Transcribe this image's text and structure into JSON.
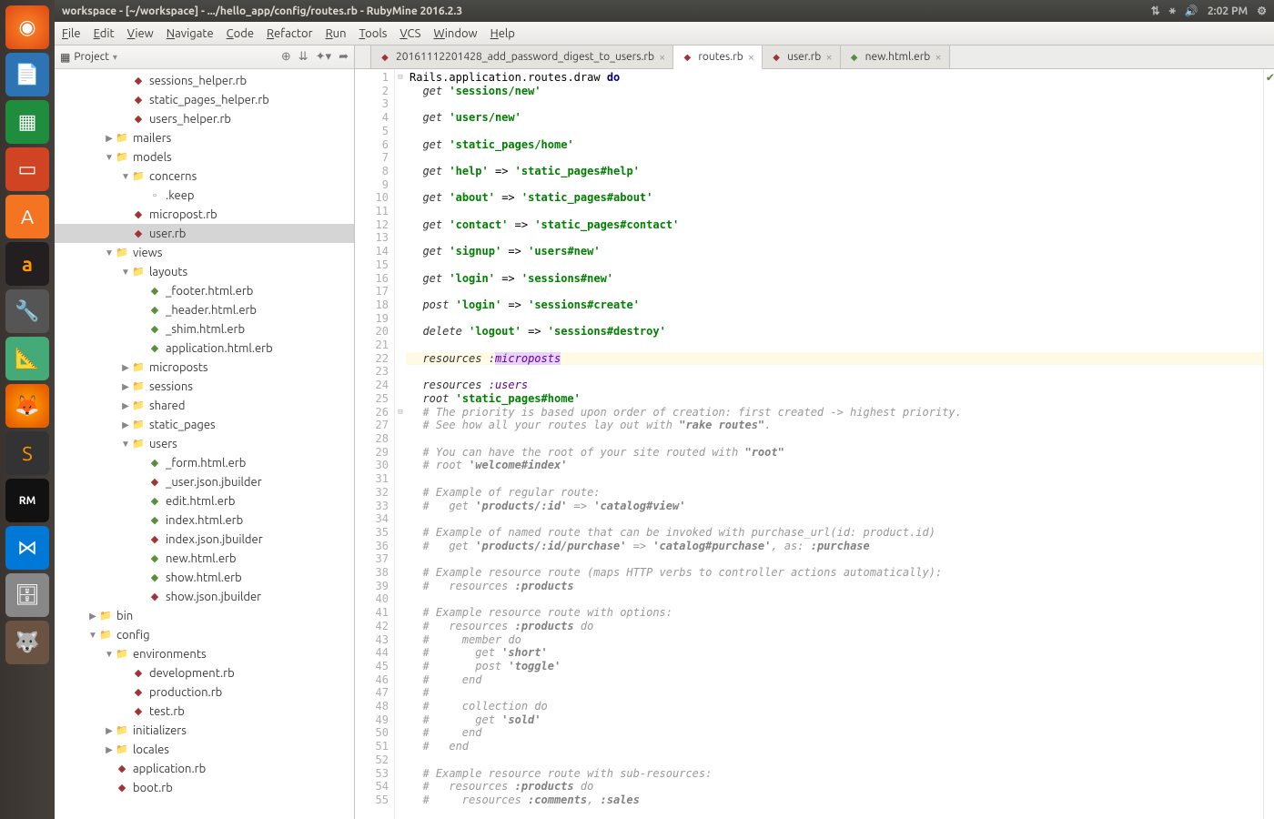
{
  "topbar": {
    "title": "workspace - [~/workspace] - .../hello_app/config/routes.rb - RubyMine 2016.2.3",
    "time": "2:02 PM"
  },
  "menubar": [
    "File",
    "Edit",
    "View",
    "Navigate",
    "Code",
    "Refactor",
    "Run",
    "Tools",
    "VCS",
    "Window",
    "Help"
  ],
  "project_panel_label": "Project",
  "tree": [
    {
      "d": 4,
      "t": "file-rb",
      "n": "sessions_helper.rb"
    },
    {
      "d": 4,
      "t": "file-rb",
      "n": "static_pages_helper.rb"
    },
    {
      "d": 4,
      "t": "file-rb",
      "n": "users_helper.rb"
    },
    {
      "d": 3,
      "t": "folder",
      "n": "mailers",
      "a": "▶"
    },
    {
      "d": 3,
      "t": "folder",
      "n": "models",
      "a": "▼"
    },
    {
      "d": 4,
      "t": "folder",
      "n": "concerns",
      "a": "▼"
    },
    {
      "d": 5,
      "t": "file",
      "n": ".keep"
    },
    {
      "d": 4,
      "t": "file-rb",
      "n": "micropost.rb"
    },
    {
      "d": 4,
      "t": "file-rb",
      "n": "user.rb",
      "sel": true
    },
    {
      "d": 3,
      "t": "folder",
      "n": "views",
      "a": "▼"
    },
    {
      "d": 4,
      "t": "folder",
      "n": "layouts",
      "a": "▼"
    },
    {
      "d": 5,
      "t": "file-erb",
      "n": "_footer.html.erb"
    },
    {
      "d": 5,
      "t": "file-erb",
      "n": "_header.html.erb"
    },
    {
      "d": 5,
      "t": "file-erb",
      "n": "_shim.html.erb"
    },
    {
      "d": 5,
      "t": "file-erb",
      "n": "application.html.erb"
    },
    {
      "d": 4,
      "t": "folder",
      "n": "microposts",
      "a": "▶"
    },
    {
      "d": 4,
      "t": "folder",
      "n": "sessions",
      "a": "▶"
    },
    {
      "d": 4,
      "t": "folder",
      "n": "shared",
      "a": "▶"
    },
    {
      "d": 4,
      "t": "folder",
      "n": "static_pages",
      "a": "▶"
    },
    {
      "d": 4,
      "t": "folder",
      "n": "users",
      "a": "▼"
    },
    {
      "d": 5,
      "t": "file-erb",
      "n": "_form.html.erb"
    },
    {
      "d": 5,
      "t": "file-rb",
      "n": "_user.json.jbuilder"
    },
    {
      "d": 5,
      "t": "file-erb",
      "n": "edit.html.erb"
    },
    {
      "d": 5,
      "t": "file-erb",
      "n": "index.html.erb"
    },
    {
      "d": 5,
      "t": "file-rb",
      "n": "index.json.jbuilder"
    },
    {
      "d": 5,
      "t": "file-erb",
      "n": "new.html.erb"
    },
    {
      "d": 5,
      "t": "file-erb",
      "n": "show.html.erb"
    },
    {
      "d": 5,
      "t": "file-rb",
      "n": "show.json.jbuilder"
    },
    {
      "d": 2,
      "t": "folder",
      "n": "bin",
      "a": "▶"
    },
    {
      "d": 2,
      "t": "folder",
      "n": "config",
      "a": "▼"
    },
    {
      "d": 3,
      "t": "folder",
      "n": "environments",
      "a": "▼"
    },
    {
      "d": 4,
      "t": "file-rb",
      "n": "development.rb"
    },
    {
      "d": 4,
      "t": "file-rb",
      "n": "production.rb"
    },
    {
      "d": 4,
      "t": "file-rb",
      "n": "test.rb"
    },
    {
      "d": 3,
      "t": "folder",
      "n": "initializers",
      "a": "▶"
    },
    {
      "d": 3,
      "t": "folder",
      "n": "locales",
      "a": "▶"
    },
    {
      "d": 3,
      "t": "file-rb",
      "n": "application.rb"
    },
    {
      "d": 3,
      "t": "file-rb",
      "n": "boot.rb"
    }
  ],
  "tabs": [
    {
      "icon": "rb",
      "label": "20161112201428_add_password_digest_to_users.rb",
      "active": false
    },
    {
      "icon": "rb",
      "label": "routes.rb",
      "active": true
    },
    {
      "icon": "rb",
      "label": "user.rb",
      "active": false
    },
    {
      "icon": "erb",
      "label": "new.html.erb",
      "active": false
    }
  ],
  "line_start": 1,
  "line_end": 55,
  "highlight_line": 22,
  "code_lines": [
    "<span class='id'>Rails</span><span class='pu'>.</span><span class='id'>application</span><span class='pu'>.</span><span class='id'>routes</span><span class='pu'>.</span><span class='id'>draw</span> <span class='kw'>do</span>",
    "  <span class='func'>get</span> <span class='str'>'sessions/new'</span>",
    "",
    "  <span class='func'>get</span> <span class='str'>'users/new'</span>",
    "",
    "  <span class='func'>get</span> <span class='str'>'static_pages/home'</span>",
    "",
    "  <span class='func'>get</span> <span class='str'>'help'</span> <span class='pu'>=&gt;</span> <span class='str'>'static_pages#help'</span>",
    "",
    "  <span class='func'>get</span> <span class='str'>'about'</span> <span class='pu'>=&gt;</span> <span class='str'>'static_pages#about'</span>",
    "",
    "  <span class='func'>get</span> <span class='str'>'contact'</span> <span class='pu'>=&gt;</span> <span class='str'>'static_pages#contact'</span>",
    "",
    "  <span class='func'>get</span> <span class='str'>'signup'</span> <span class='pu'>=&gt;</span> <span class='str'>'users#new'</span>",
    "",
    "  <span class='func'>get</span> <span class='str'>'login'</span> <span class='pu'>=&gt;</span> <span class='str'>'sessions#new'</span>",
    "",
    "  <span class='func'>post</span> <span class='str'>'login'</span> <span class='pu'>=&gt;</span> <span class='str'>'sessions#create'</span>",
    "",
    "  <span class='func'>delete</span> <span class='str'>'logout'</span> <span class='pu'>=&gt;</span> <span class='str'>'sessions#destroy'</span>",
    "",
    "  <span class='func'>resources</span> <span class='sym'>:</span><span class='hl-sym'>microposts</span>",
    "",
    "  <span class='func'>resources</span> <span class='sym'>:users</span>",
    "  <span class='func'>root</span> <span class='str'>'static_pages#home'</span>",
    "  <span class='cm'># The priority is based upon order of creation: first created -> highest priority.</span>",
    "  <span class='cm'># See how all your routes lay out with </span><span class='cm2'>\"rake routes\"</span><span class='cm'>.</span>",
    "",
    "  <span class='cm'># You can have the root of your site routed with </span><span class='cm2'>\"root\"</span>",
    "  <span class='cm'># root </span><span class='cm2'>'welcome#index'</span>",
    "",
    "  <span class='cm'># Example of regular route:</span>",
    "  <span class='cm'>#   get </span><span class='cm2'>'products/:id'</span><span class='cm'> =&gt; </span><span class='cm2'>'catalog#view'</span>",
    "",
    "  <span class='cm'># Example of named route that can be invoked with purchase_url(id: product.id)</span>",
    "  <span class='cm'>#   get </span><span class='cm2'>'products/:id/purchase'</span><span class='cm'> =&gt; </span><span class='cm2'>'catalog#purchase'</span><span class='cm'>, as: </span><span class='cm2'>:purchase</span>",
    "",
    "  <span class='cm'># Example resource route (maps HTTP verbs to controller actions automatically):</span>",
    "  <span class='cm'>#   resources </span><span class='cm2'>:products</span>",
    "",
    "  <span class='cm'># Example resource route with options:</span>",
    "  <span class='cm'>#   resources </span><span class='cm2'>:products</span><span class='cm'> do</span>",
    "  <span class='cm'>#     member do</span>",
    "  <span class='cm'>#       get </span><span class='cm2'>'short'</span>",
    "  <span class='cm'>#       post </span><span class='cm2'>'toggle'</span>",
    "  <span class='cm'>#     end</span>",
    "  <span class='cm'>#</span>",
    "  <span class='cm'>#     collection do</span>",
    "  <span class='cm'>#       get </span><span class='cm2'>'sold'</span>",
    "  <span class='cm'>#     end</span>",
    "  <span class='cm'>#   end</span>",
    "",
    "  <span class='cm'># Example resource route with sub-resources:</span>",
    "  <span class='cm'>#   resources </span><span class='cm2'>:products</span><span class='cm'> do</span>",
    "  <span class='cm'>#     resources </span><span class='cm2'>:comments</span><span class='cm'>, </span><span class='cm2'>:sales</span>"
  ],
  "launcher": [
    "ubuntu",
    "writer",
    "calc",
    "impress",
    "software",
    "amazon",
    "settings",
    "calc2",
    "firefox",
    "sublime",
    "rubymine",
    "vscode",
    "files",
    "gimp"
  ]
}
